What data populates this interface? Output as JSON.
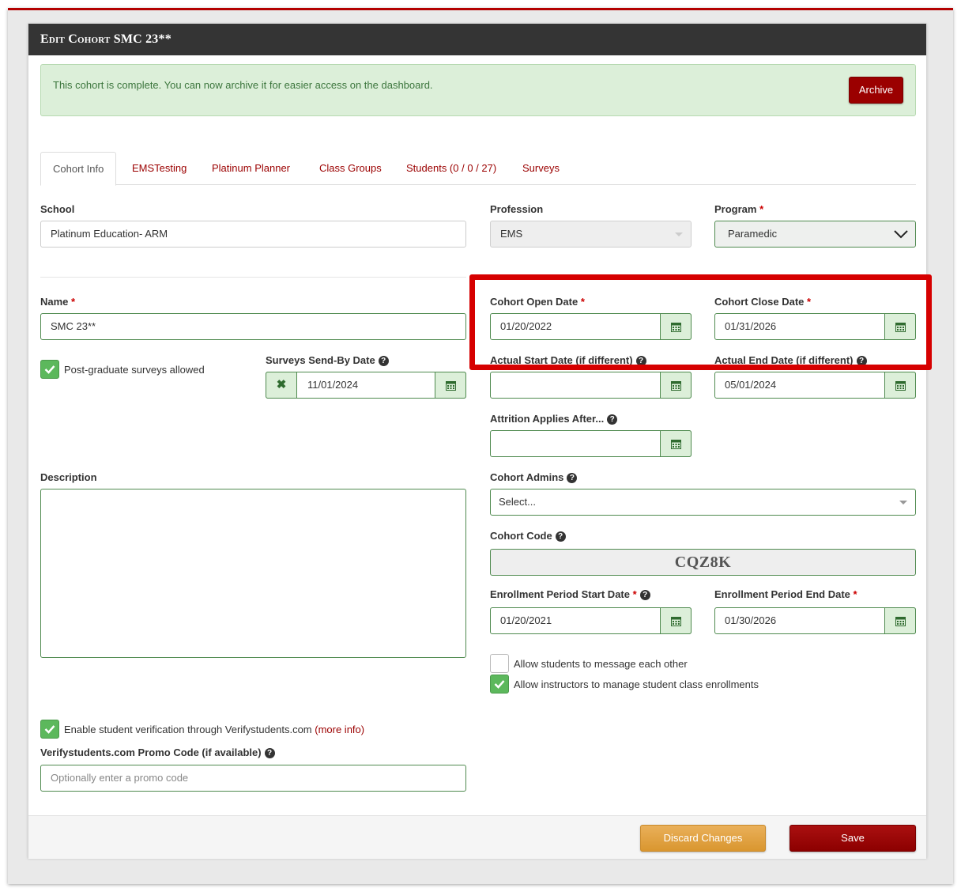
{
  "header": {
    "title": "Edit Cohort SMC 23**"
  },
  "alert": {
    "message": "This cohort is complete. You can now archive it for easier access on the dashboard.",
    "archive_label": "Archive"
  },
  "tabs": [
    {
      "label": "Cohort Info",
      "active": true
    },
    {
      "label": "EMSTesting"
    },
    {
      "label": "Platinum Planner"
    },
    {
      "label": "Class Groups"
    },
    {
      "label": "Students (0 / 0 / 27)"
    },
    {
      "label": "Surveys"
    }
  ],
  "school": {
    "label": "School",
    "value": "Platinum Education- ARM"
  },
  "profession": {
    "label": "Profession",
    "value": "EMS"
  },
  "program": {
    "label": "Program",
    "required": "*",
    "value": "Paramedic"
  },
  "name": {
    "label": "Name",
    "required": "*",
    "value": "SMC 23**"
  },
  "post_grad_surveys": {
    "label": "Post-graduate surveys allowed",
    "checked": true
  },
  "surveys_send_by": {
    "label": "Surveys Send-By Date",
    "value": "11/01/2024"
  },
  "cohort_open_date": {
    "label": "Cohort Open Date",
    "required": "*",
    "value": "01/20/2022"
  },
  "cohort_close_date": {
    "label": "Cohort Close Date",
    "required": "*",
    "value": "01/31/2026"
  },
  "actual_start_date": {
    "label": "Actual Start Date (if different)",
    "value": ""
  },
  "actual_end_date": {
    "label": "Actual End Date (if different)",
    "value": "05/01/2024"
  },
  "attrition": {
    "label": "Attrition Applies After...",
    "value": ""
  },
  "description": {
    "label": "Description",
    "value": ""
  },
  "cohort_admins": {
    "label": "Cohort Admins",
    "placeholder": "Select..."
  },
  "cohort_code": {
    "label": "Cohort Code",
    "value": "CQZ8K"
  },
  "enrollment_start": {
    "label": "Enrollment Period Start Date",
    "required": "*",
    "value": "01/20/2021"
  },
  "enrollment_end": {
    "label": "Enrollment Period End Date",
    "required": "*",
    "value": "01/30/2026"
  },
  "allow_messaging": {
    "label": "Allow students to message each other",
    "checked": false
  },
  "allow_instructors": {
    "label": "Allow instructors to manage student class enrollments",
    "checked": true
  },
  "verification": {
    "label": "Enable student verification through Verifystudents.com",
    "link": "(more info)",
    "checked": true
  },
  "promo_code": {
    "label": "Verifystudents.com Promo Code (if available)",
    "placeholder": "Optionally enter a promo code"
  },
  "footer": {
    "discard_label": "Discard Changes",
    "save_label": "Save"
  },
  "colors": {
    "brand_red": "#9b0000",
    "success_green": "#5cb85c",
    "highlight_red": "#d60000",
    "discard_orange": "#e0a040"
  }
}
